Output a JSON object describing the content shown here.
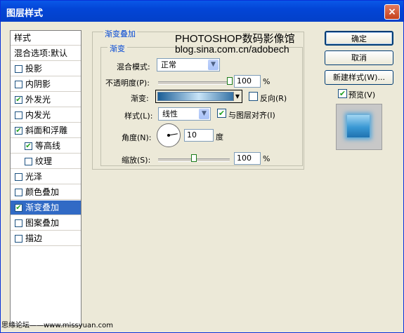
{
  "window": {
    "title": "图层样式",
    "close_label": "×"
  },
  "sidebar": {
    "header": "样式",
    "blend_default": "混合选项:默认",
    "items": [
      {
        "label": "投影",
        "checked": false,
        "selected": false
      },
      {
        "label": "内阴影",
        "checked": false,
        "selected": false
      },
      {
        "label": "外发光",
        "checked": true,
        "selected": false
      },
      {
        "label": "内发光",
        "checked": false,
        "selected": false
      },
      {
        "label": "斜面和浮雕",
        "checked": true,
        "selected": false
      },
      {
        "label": "等高线",
        "checked": true,
        "selected": false,
        "sub": true
      },
      {
        "label": "纹理",
        "checked": false,
        "selected": false,
        "sub": true
      },
      {
        "label": "光泽",
        "checked": false,
        "selected": false
      },
      {
        "label": "颜色叠加",
        "checked": false,
        "selected": false
      },
      {
        "label": "渐变叠加",
        "checked": true,
        "selected": true
      },
      {
        "label": "图案叠加",
        "checked": false,
        "selected": false
      },
      {
        "label": "描边",
        "checked": false,
        "selected": false
      }
    ]
  },
  "panel": {
    "group_title": "渐变叠加",
    "inner_title": "渐变",
    "blend_mode_label": "混合模式:",
    "blend_mode_value": "正常",
    "opacity_label": "不透明度(P):",
    "opacity_value": "100",
    "opacity_unit": "%",
    "opacity_level": 1.0,
    "gradient_label": "渐变:",
    "reverse_label": "反向(R)",
    "reverse_checked": false,
    "style_label": "样式(L):",
    "style_value": "线性",
    "align_label": "与图层对齐(I)",
    "align_checked": true,
    "angle_label": "角度(N):",
    "angle_value": "10",
    "angle_unit": "度",
    "scale_label": "缩放(S):",
    "scale_value": "100",
    "scale_unit": "%",
    "scale_level": 0.5
  },
  "watermark": {
    "line1": "PHOTOSHOP数码影像馆",
    "line2": "blog.sina.com.cn/adobech"
  },
  "buttons": {
    "ok": "确定",
    "cancel": "取消",
    "new_style": "新建样式(W)...",
    "preview_label": "预览(V)",
    "preview_checked": true
  },
  "footer": "思缘论坛——www.missyuan.com",
  "icons": {
    "check": "✔",
    "dropdown": "▼",
    "close": "×"
  },
  "colors": {
    "titlebar": "#0345d6",
    "selection": "#316ac5",
    "group_title": "#0046d5"
  }
}
